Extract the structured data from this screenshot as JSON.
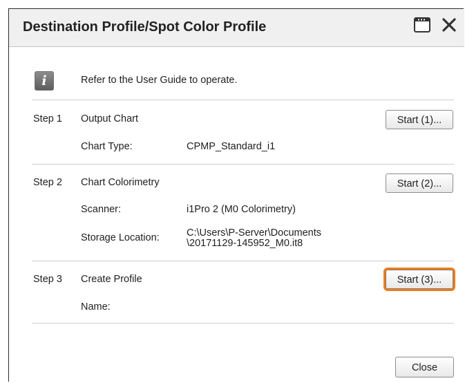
{
  "window": {
    "title": "Destination Profile/Spot Color Profile"
  },
  "info": {
    "icon": "info-icon",
    "text": "Refer to the User Guide to operate."
  },
  "steps": [
    {
      "label": "Step 1",
      "name": "Output Chart",
      "button": "Start (1)...",
      "fields": [
        {
          "label": "Chart Type:",
          "value": "CPMP_Standard_i1"
        }
      ]
    },
    {
      "label": "Step 2",
      "name": "Chart Colorimetry",
      "button": "Start (2)...",
      "fields": [
        {
          "label": "Scanner:",
          "value": "i1Pro 2 (M0 Colorimetry)"
        },
        {
          "label": "Storage Location:",
          "value": "C:\\Users\\P-Server\\Documents\n\\20171129-145952_M0.it8"
        }
      ]
    },
    {
      "label": "Step 3",
      "name": "Create Profile",
      "button": "Start (3)...",
      "fields": [
        {
          "label": "Name:",
          "value": ""
        }
      ]
    }
  ],
  "footer": {
    "close_label": "Close"
  },
  "colors": {
    "highlight": "#f07d1a",
    "titlebar_bg": "#f0f0f0"
  }
}
